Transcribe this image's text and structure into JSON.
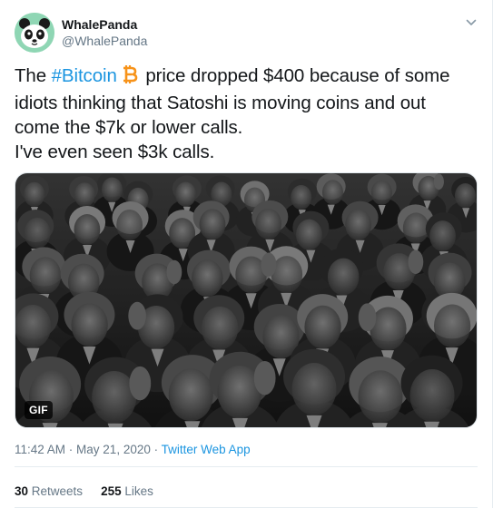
{
  "author": {
    "display_name": "WhalePanda",
    "handle": "@WhalePanda",
    "avatar_icon": "panda-avatar-icon"
  },
  "tweet": {
    "line1_prefix": "The ",
    "hashtag": "#Bitcoin",
    "line1_suffix": " price dropped $400 because of some",
    "line2": "idiots thinking that Satoshi is moving coins and out",
    "line3": "come the $7k or lower calls.",
    "line4": "I've even seen $3k calls.",
    "emoji_icon": "bitcoin-emoji-icon"
  },
  "media": {
    "badge": "GIF"
  },
  "meta": {
    "time": "11:42 AM",
    "separator1": " · ",
    "date": "May 21, 2020",
    "separator2": " · ",
    "source": "Twitter Web App"
  },
  "stats": {
    "retweets_count": "30",
    "retweets_label": " Retweets",
    "likes_count": "255",
    "likes_label": " Likes"
  },
  "colors": {
    "link": "#1b95e0",
    "secondary_text": "#657786",
    "bitcoin_orange": "#f7931a",
    "avatar_bg": "#8fd6b4"
  }
}
